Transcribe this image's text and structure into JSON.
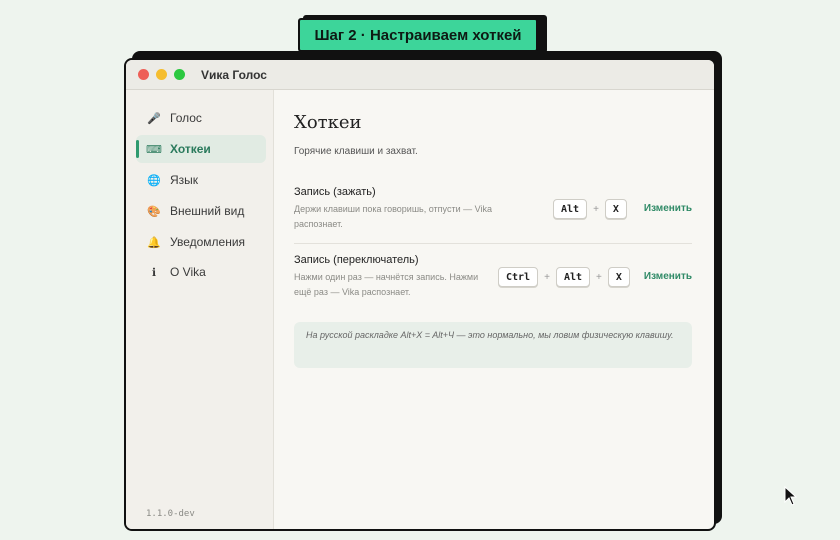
{
  "step_label": "Шаг 2 · Настраиваем хоткей",
  "window": {
    "title": "Vика Голос"
  },
  "sidebar": {
    "items": [
      {
        "label": "Голос",
        "icon": "microphone-icon",
        "active": false
      },
      {
        "label": "Хоткеи",
        "icon": "keyboard-icon",
        "active": true
      },
      {
        "label": "Язык",
        "icon": "globe-icon",
        "active": false
      },
      {
        "label": "Внешний вид",
        "icon": "palette-icon",
        "active": false
      },
      {
        "label": "Уведомления",
        "icon": "bell-icon",
        "active": false
      },
      {
        "label": "О Vika",
        "icon": "info-icon",
        "active": false
      }
    ],
    "version": "1.1.0-dev"
  },
  "content": {
    "title": "Хоткеи",
    "subtitle": "Горячие клавиши и захват.",
    "hotkeys": [
      {
        "title": "Запись (зажать)",
        "desc": "Держи клавиши пока говоришь, отпусти — Vika распознает.",
        "keys": [
          "Alt",
          "X"
        ],
        "change_label": "Изменить"
      },
      {
        "title": "Запись (переключатель)",
        "desc": "Нажми один раз — начнётся запись. Нажми ещё раз — Vika распознает.",
        "keys": [
          "Ctrl",
          "Alt",
          "X"
        ],
        "change_label": "Изменить"
      }
    ],
    "plus_sign": "+",
    "note": "На русской раскладке Alt+X = Alt+Ч — это нормально, мы ловим физическую клавишу."
  },
  "colors": {
    "accent": "#2f9a6f",
    "step_label_bg": "#3dd59a",
    "background": "#eef4ee"
  }
}
